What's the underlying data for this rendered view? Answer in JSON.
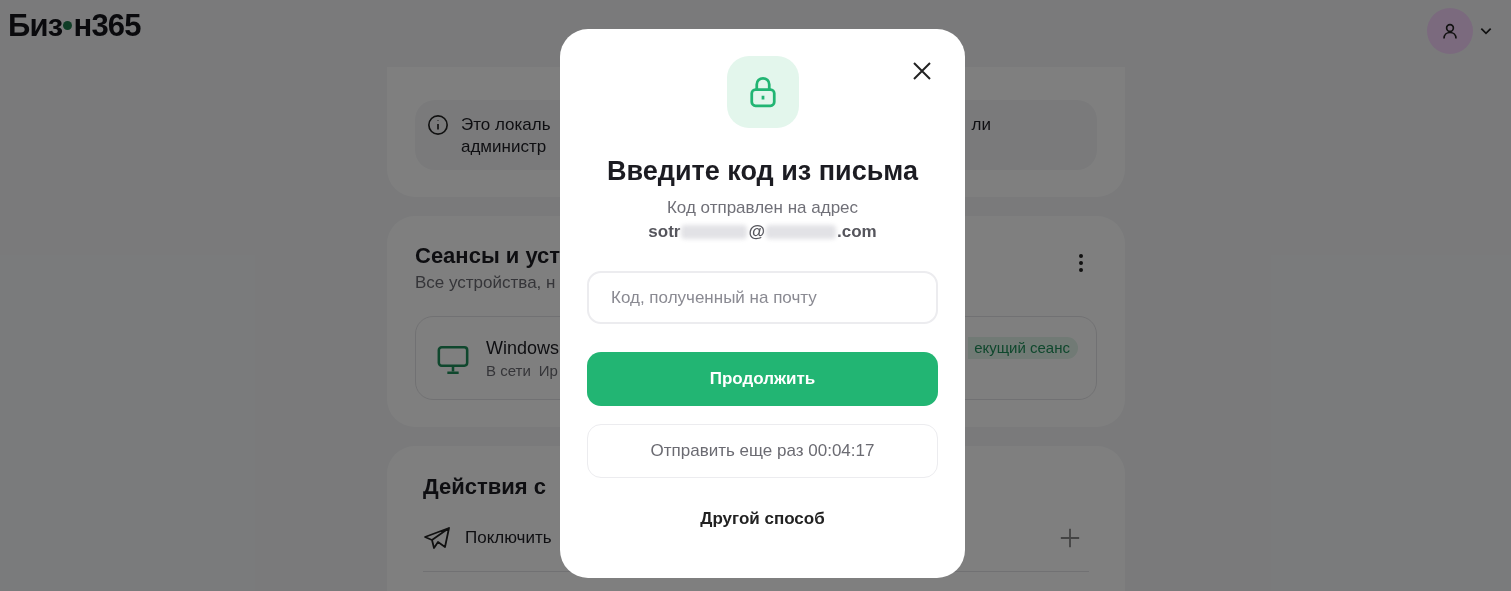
{
  "header": {
    "logo_left": "Биз",
    "logo_right": "н365"
  },
  "notice": {
    "line_1": "Это локаль",
    "line_2": "администр",
    "line_1_end": "ли"
  },
  "sessions": {
    "title": "Сеансы и уст",
    "subtitle": "Все устройства, н",
    "device": {
      "name": "Windows",
      "status": "В сети",
      "location": "Ир",
      "badge": "екущий сеанс"
    }
  },
  "actions": {
    "title": "Действия с",
    "items": [
      {
        "label": "Поключить"
      }
    ]
  },
  "modal": {
    "title": "Введите код из письма",
    "subtitle": "Код отправлен на адрес",
    "email_start": "sotr",
    "email_at": "@",
    "email_end": ".com",
    "input": {
      "placeholder": "Код, полученный на почту"
    },
    "submit": "Продолжить",
    "resend": "Отправить еще раз 00:04:17",
    "other": "Другой способ"
  }
}
